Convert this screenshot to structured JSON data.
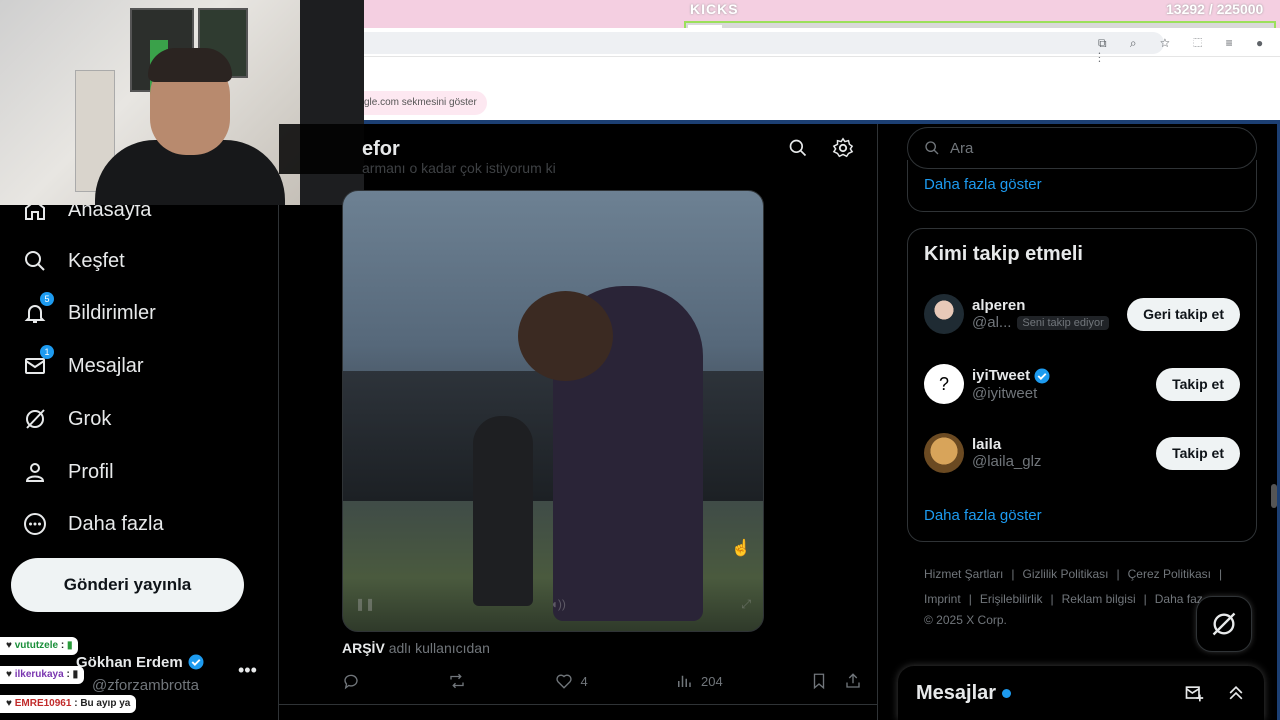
{
  "overlay": {
    "title": "KICKS",
    "count": "13292",
    "goal": "/ 225000",
    "progress": 0.059,
    "tab_hint": "gle.com sekmesini göster"
  },
  "header": {
    "title": "efor",
    "faded_text": "armanı o kadar çok istiyorum ki"
  },
  "sidebar": {
    "items": [
      {
        "label": "Anasayfa",
        "icon": "home-icon"
      },
      {
        "label": "Keşfet",
        "icon": "search-icon"
      },
      {
        "label": "Bildirimler",
        "icon": "bell-icon",
        "badge": "5"
      },
      {
        "label": "Mesajlar",
        "icon": "mail-icon",
        "badge": "1"
      },
      {
        "label": "Grok",
        "icon": "grok-icon"
      },
      {
        "label": "Profil",
        "icon": "person-icon"
      },
      {
        "label": "Daha fazla",
        "icon": "more-circle-icon"
      }
    ],
    "post_button": "Gönderi yayınla",
    "profile": {
      "name": "Gökhan Erdem",
      "handle": "@zforzambrotta"
    }
  },
  "chat": [
    {
      "user": "vututzele",
      "sep": ":",
      "text": ""
    },
    {
      "user": "ilkerukaya",
      "sep": ":",
      "text": ""
    },
    {
      "user": "EMRE10961",
      "sep": ":",
      "text": "Bu ayıp ya"
    }
  ],
  "tweet": {
    "source_user": "ARŞİV",
    "source_suffix": "adlı kullanıcıdan",
    "likes": "4",
    "views": "204"
  },
  "right": {
    "search_placeholder": "Ara",
    "show_more_1": "Daha fazla göster",
    "who_to_follow": "Kimi takip etmeli",
    "suggestions": [
      {
        "name": "alperen",
        "handle": "@al...",
        "follows_you": "Seni takip ediyor",
        "button": "Geri takip et",
        "verified": false,
        "avatar_color": "#3a6b8c"
      },
      {
        "name": "iyiTweet",
        "handle": "@iyitweet",
        "follows_you": "",
        "button": "Takip et",
        "verified": true,
        "avatar_color": "#ffffff"
      },
      {
        "name": "laila",
        "handle": "@laila_glz",
        "follows_you": "",
        "button": "Takip et",
        "verified": false,
        "avatar_color": "#c98c3a"
      }
    ],
    "show_more_2": "Daha fazla göster",
    "footer": [
      "Hizmet Şartları",
      "Gizlilik Politikası",
      "Çerez Politikası",
      "Imprint",
      "Erişilebilirlik",
      "Reklam bilgisi",
      "Daha faz"
    ],
    "copyright": "© 2025 X Corp.",
    "messages_title": "Mesajlar"
  },
  "colors": {
    "accent": "#1d9bf0",
    "background": "#000000",
    "overlay_pink": "#f4cfe1",
    "progress_border": "#9be05b"
  }
}
